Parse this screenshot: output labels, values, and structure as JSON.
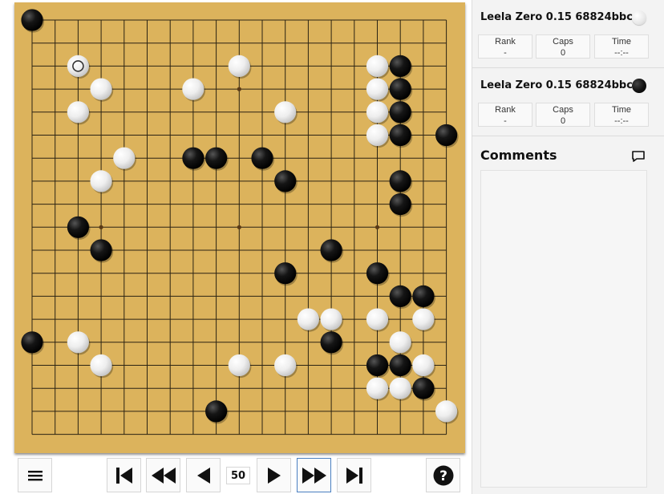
{
  "board": {
    "size": 19,
    "background": "#dcb35c",
    "line_color": "#2b2313",
    "hoshi": [
      [
        3,
        3
      ],
      [
        9,
        3
      ],
      [
        15,
        3
      ],
      [
        3,
        9
      ],
      [
        9,
        9
      ],
      [
        15,
        9
      ],
      [
        3,
        15
      ],
      [
        9,
        15
      ],
      [
        15,
        15
      ]
    ],
    "last_move": [
      2,
      2
    ],
    "stones": {
      "black": [
        [
          0,
          0
        ],
        [
          16,
          2
        ],
        [
          16,
          3
        ],
        [
          16,
          4
        ],
        [
          16,
          5
        ],
        [
          18,
          5
        ],
        [
          7,
          6
        ],
        [
          8,
          6
        ],
        [
          10,
          6
        ],
        [
          11,
          7
        ],
        [
          16,
          7
        ],
        [
          16,
          8
        ],
        [
          2,
          9
        ],
        [
          3,
          10
        ],
        [
          13,
          10
        ],
        [
          11,
          11
        ],
        [
          15,
          11
        ],
        [
          16,
          12
        ],
        [
          17,
          12
        ],
        [
          0,
          14
        ],
        [
          13,
          14
        ],
        [
          15,
          15
        ],
        [
          16,
          15
        ],
        [
          17,
          16
        ],
        [
          8,
          17
        ]
      ],
      "white": [
        [
          2,
          2
        ],
        [
          9,
          2
        ],
        [
          15,
          2
        ],
        [
          3,
          3
        ],
        [
          7,
          3
        ],
        [
          15,
          3
        ],
        [
          2,
          4
        ],
        [
          11,
          4
        ],
        [
          15,
          4
        ],
        [
          15,
          5
        ],
        [
          4,
          6
        ],
        [
          3,
          7
        ],
        [
          12,
          13
        ],
        [
          13,
          13
        ],
        [
          15,
          13
        ],
        [
          17,
          13
        ],
        [
          2,
          14
        ],
        [
          16,
          14
        ],
        [
          3,
          15
        ],
        [
          9,
          15
        ],
        [
          11,
          15
        ],
        [
          17,
          15
        ],
        [
          15,
          16
        ],
        [
          16,
          16
        ],
        [
          18,
          17
        ]
      ]
    }
  },
  "controls": {
    "move_number": "50",
    "menu_icon": "hamburger-icon",
    "first_icon": "skip-to-first-icon",
    "back_many_icon": "rewind-icon",
    "back_icon": "step-back-icon",
    "forward_icon": "step-forward-icon",
    "forward_many_icon": "fast-forward-icon",
    "last_icon": "skip-to-last-icon",
    "help_icon": "help-icon"
  },
  "players": [
    {
      "name": "Leela Zero 0.15 68824bbc",
      "color": "white",
      "rank_label": "Rank",
      "rank": "-",
      "caps_label": "Caps",
      "caps": "0",
      "time_label": "Time",
      "time": "--:--"
    },
    {
      "name": "Leela Zero 0.15 68824bbc",
      "color": "black",
      "rank_label": "Rank",
      "rank": "-",
      "caps_label": "Caps",
      "caps": "0",
      "time_label": "Time",
      "time": "--:--"
    }
  ],
  "comments": {
    "title": "Comments",
    "icon": "comment-icon"
  }
}
